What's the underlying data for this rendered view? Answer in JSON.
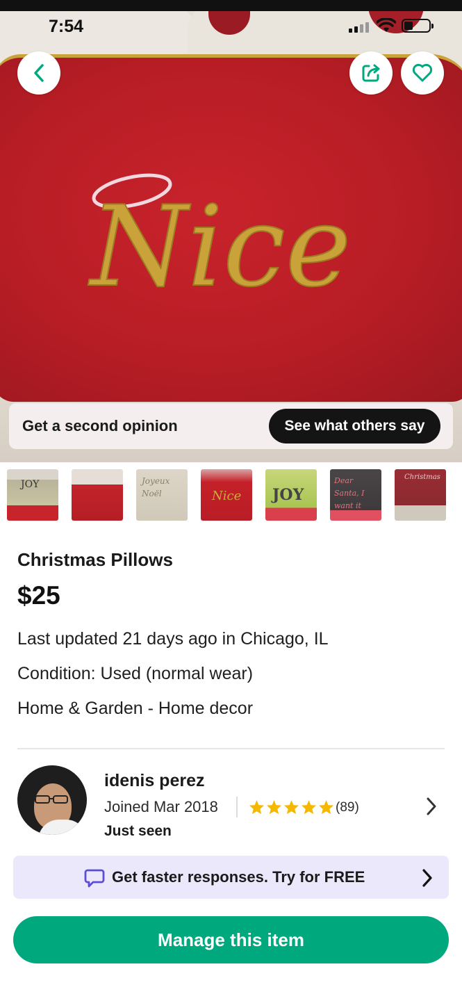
{
  "status_bar": {
    "time": "7:54"
  },
  "nav": {
    "back_icon": "chevron-left-icon",
    "share_icon": "share-icon",
    "favorite_icon": "heart-icon"
  },
  "hero": {
    "embroidered_text": "Nice"
  },
  "opinion_bar": {
    "label": "Get a second opinion",
    "cta": "See what others say"
  },
  "thumbnails": [
    {
      "text": "JOY"
    },
    {
      "text": ""
    },
    {
      "text": "Joyeux Noël"
    },
    {
      "text": "Nice"
    },
    {
      "text": "JOY"
    },
    {
      "text": "Dear Santa, I want it"
    },
    {
      "text": "Christmas"
    }
  ],
  "listing": {
    "title": "Christmas Pillows",
    "price": "$25",
    "updated": "Last updated 21 days ago in Chicago, IL",
    "condition": "Condition: Used (normal wear)",
    "category": "Home & Garden - Home decor"
  },
  "seller": {
    "name": "idenis perez",
    "joined": "Joined Mar 2018",
    "rating_stars": 5,
    "rating_count": "(89)",
    "last_seen": "Just seen"
  },
  "promo": {
    "text": "Get faster responses. Try for FREE"
  },
  "actions": {
    "manage": "Manage this item"
  },
  "colors": {
    "accent_green": "#00a87e",
    "promo_bg": "#ebe8fb",
    "star": "#f5b800",
    "chat_icon": "#5b4dd6"
  }
}
